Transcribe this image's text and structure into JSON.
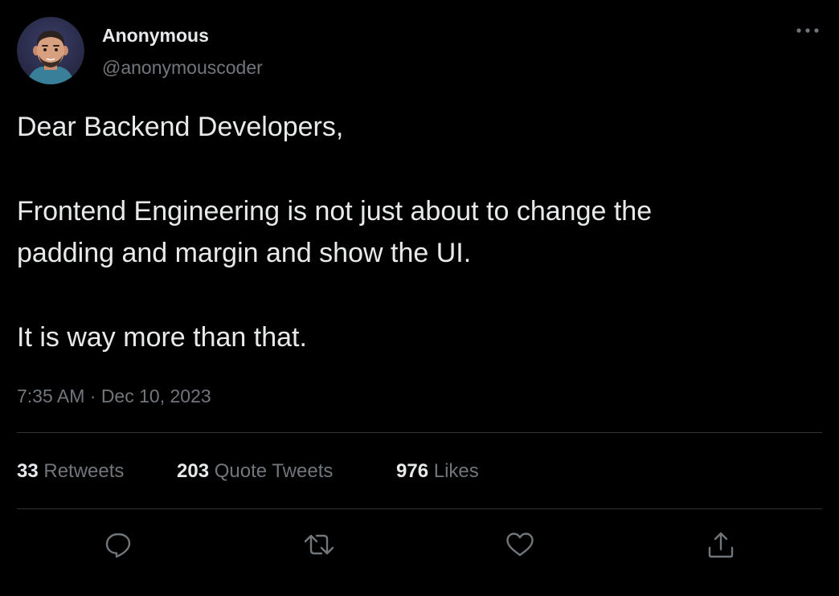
{
  "colors": {
    "background": "#000000",
    "text_primary": "#e7e9ea",
    "text_secondary": "#71767b",
    "divider": "#2f3336"
  },
  "author": {
    "display_name": "Anonymous",
    "handle": "@anonymouscoder",
    "avatar_icon": "avatar-illustration-icon"
  },
  "more_icon": "more-options-icon",
  "tweet": {
    "lines": [
      "Dear Backend Developers,",
      "Frontend Engineering is not just about to change the",
      "padding and margin and show the UI.",
      "It is way more than that."
    ],
    "timestamp": "7:35 AM · Dec 10, 2023"
  },
  "stats": {
    "retweets": {
      "count": "33",
      "label": "Retweets"
    },
    "quote_tweets": {
      "count": "203",
      "label": "Quote Tweets"
    },
    "likes": {
      "count": "976",
      "label": "Likes"
    }
  },
  "actions": [
    {
      "icon": "reply-icon"
    },
    {
      "icon": "retweet-icon"
    },
    {
      "icon": "like-icon"
    },
    {
      "icon": "share-icon"
    }
  ]
}
